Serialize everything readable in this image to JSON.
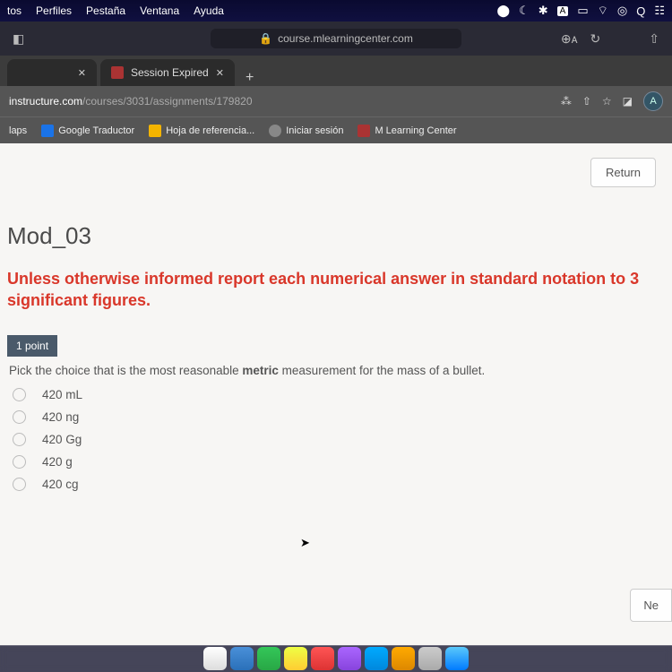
{
  "mac_menu": {
    "items": [
      "tos",
      "Perfiles",
      "Pestaña",
      "Ventana",
      "Ayuda"
    ]
  },
  "safari": {
    "url_label": "course.mlearningcenter.com"
  },
  "chrome": {
    "tabs": [
      {
        "label": "",
        "active": false
      },
      {
        "label": "Session Expired",
        "active": false
      }
    ],
    "url_domain": "instructure.com",
    "url_path": "/courses/3031/assignments/179820"
  },
  "bookmarks": [
    {
      "label": "laps"
    },
    {
      "label": "Google Traductor"
    },
    {
      "label": "Hoja de referencia..."
    },
    {
      "label": "Iniciar sesión"
    },
    {
      "label": "M Learning Center"
    }
  ],
  "page": {
    "return_label": "Return",
    "title": "Mod_03",
    "instruction": "Unless otherwise informed report each numerical answer in standard notation to 3 significant figures.",
    "points": "1 point",
    "question_pre": "Pick the choice that is the most reasonable ",
    "question_bold": "metric",
    "question_post": " measurement for the mass of a bullet.",
    "options": [
      "420 mL",
      "420 ng",
      "420 Gg",
      "420 g",
      "420 cg"
    ],
    "next_label": "Ne"
  },
  "avatar_letter": "A"
}
